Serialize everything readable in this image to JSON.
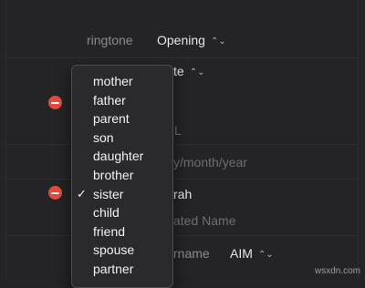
{
  "ringtone": {
    "label": "ringtone",
    "value": "Opening"
  },
  "partial_fields": {
    "row2_value_fragment": "te",
    "row3_fragment": "L",
    "date_placeholder_fragment": "y/month/year",
    "name_value_fragment": "rah",
    "related_name_placeholder_fragment": "ated Name",
    "username_label_fragment": "rname",
    "service_value": "AIM"
  },
  "relationship_menu": {
    "items": [
      {
        "label": "mother",
        "checked": false
      },
      {
        "label": "father",
        "checked": false
      },
      {
        "label": "parent",
        "checked": false
      },
      {
        "label": "son",
        "checked": false
      },
      {
        "label": "daughter",
        "checked": false
      },
      {
        "label": "brother",
        "checked": false
      },
      {
        "label": "sister",
        "checked": true
      },
      {
        "label": "child",
        "checked": false
      },
      {
        "label": "friend",
        "checked": false
      },
      {
        "label": "spouse",
        "checked": false
      },
      {
        "label": "partner",
        "checked": false
      }
    ],
    "check_glyph": "✓"
  },
  "colors": {
    "remove_button": "#e54a3f",
    "background": "#242426"
  },
  "watermark": "wsxdn.com"
}
